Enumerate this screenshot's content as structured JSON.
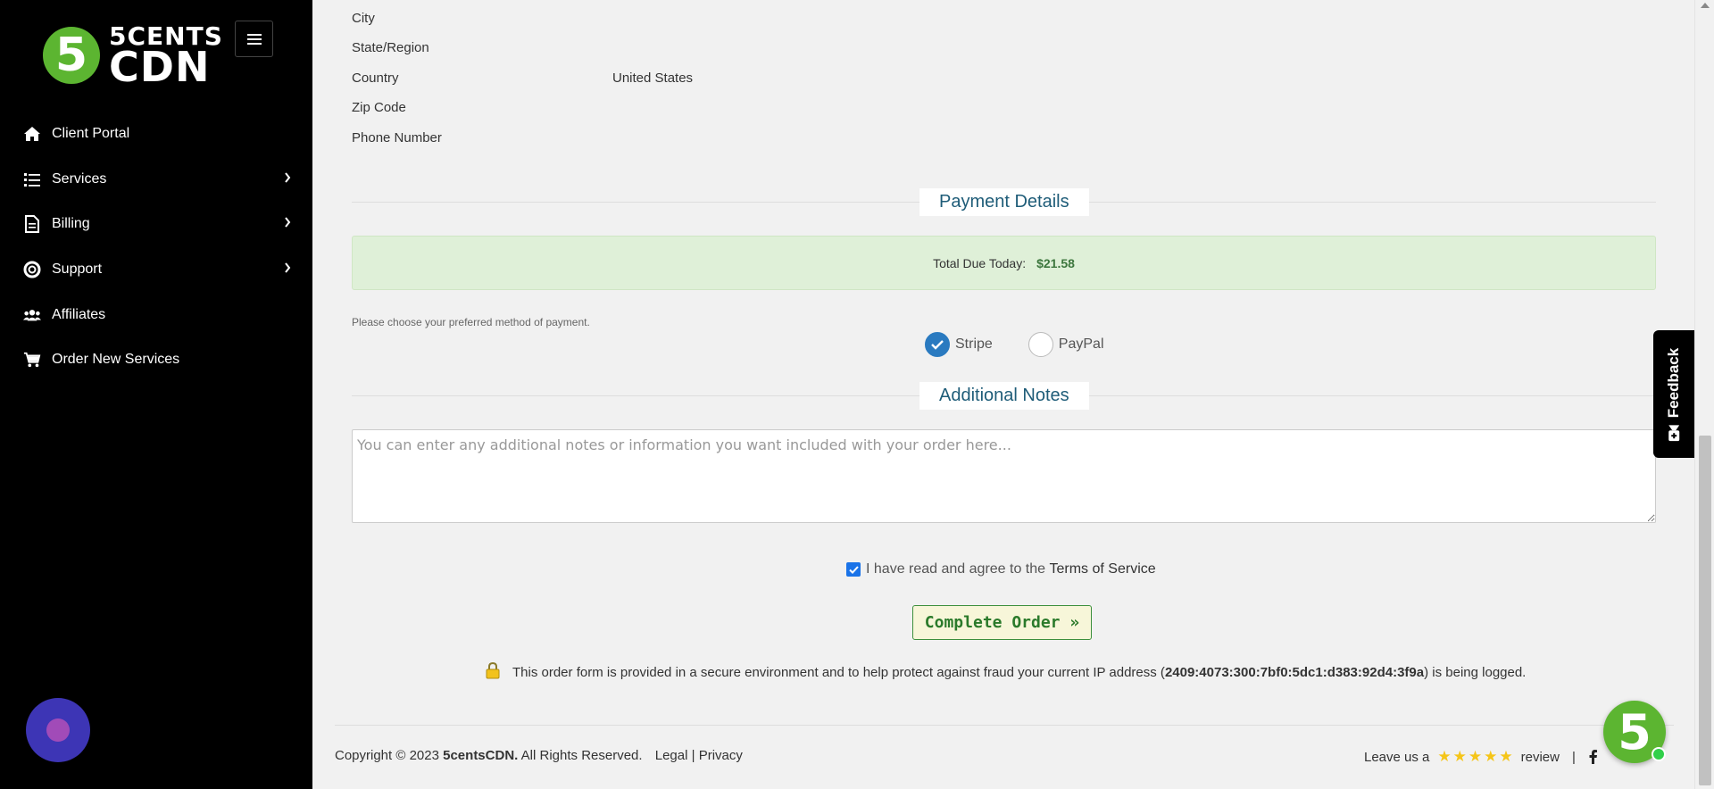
{
  "brand": {
    "logo_mark": "5",
    "logo_line1": "5CENTS",
    "logo_line2": "CDN"
  },
  "sidebar": {
    "items": [
      {
        "label": "Client Portal",
        "icon": "home-icon",
        "has_submenu": false
      },
      {
        "label": "Services",
        "icon": "list-icon",
        "has_submenu": true
      },
      {
        "label": "Billing",
        "icon": "document-icon",
        "has_submenu": true
      },
      {
        "label": "Support",
        "icon": "lifebuoy-icon",
        "has_submenu": true
      },
      {
        "label": "Affiliates",
        "icon": "users-icon",
        "has_submenu": false
      },
      {
        "label": "Order New Services",
        "icon": "cart-icon",
        "has_submenu": false
      }
    ]
  },
  "address": {
    "city_label": "City",
    "state_label": "State/Region",
    "country_label": "Country",
    "country_value": "United States",
    "zip_label": "Zip Code",
    "phone_label": "Phone Number"
  },
  "payment": {
    "title": "Payment Details",
    "due_label": "Total Due Today:",
    "due_amount": "$21.58",
    "hint": "Please choose your preferred method of payment.",
    "options": [
      {
        "label": "Stripe",
        "selected": true
      },
      {
        "label": "PayPal",
        "selected": false
      }
    ]
  },
  "notes": {
    "title": "Additional Notes",
    "placeholder": "You can enter any additional notes or information you want included with your order here..."
  },
  "terms": {
    "checked": true,
    "text": "I have read and agree to the",
    "link": "Terms of Service"
  },
  "order": {
    "button_label": "Complete Order »"
  },
  "security": {
    "text_before": "This order form is provided in a secure environment and to help protect against fraud your current IP address (",
    "ip": "2409:4073:300:7bf0:5dc1:d383:92d4:3f9a",
    "text_after": ") is being logged."
  },
  "footer": {
    "copyright": "Copyright © 2023",
    "company": "5centsCDN.",
    "rights": "All Rights Reserved.",
    "legal": "Legal",
    "separator": "|",
    "privacy": "Privacy",
    "review_prefix": "Leave us a",
    "review_suffix": "review",
    "review_separator": "|",
    "rating": 5
  },
  "widgets": {
    "feedback_label": "Feedback",
    "badge_mark": "5"
  },
  "colors": {
    "sidebar_bg": "#000000",
    "brand_green": "#5cb531",
    "heading_blue": "#1e5c78",
    "due_bg": "#dff0d8",
    "radio_selected": "#2a7ac0",
    "chat_bubble": "#3d35b5"
  }
}
